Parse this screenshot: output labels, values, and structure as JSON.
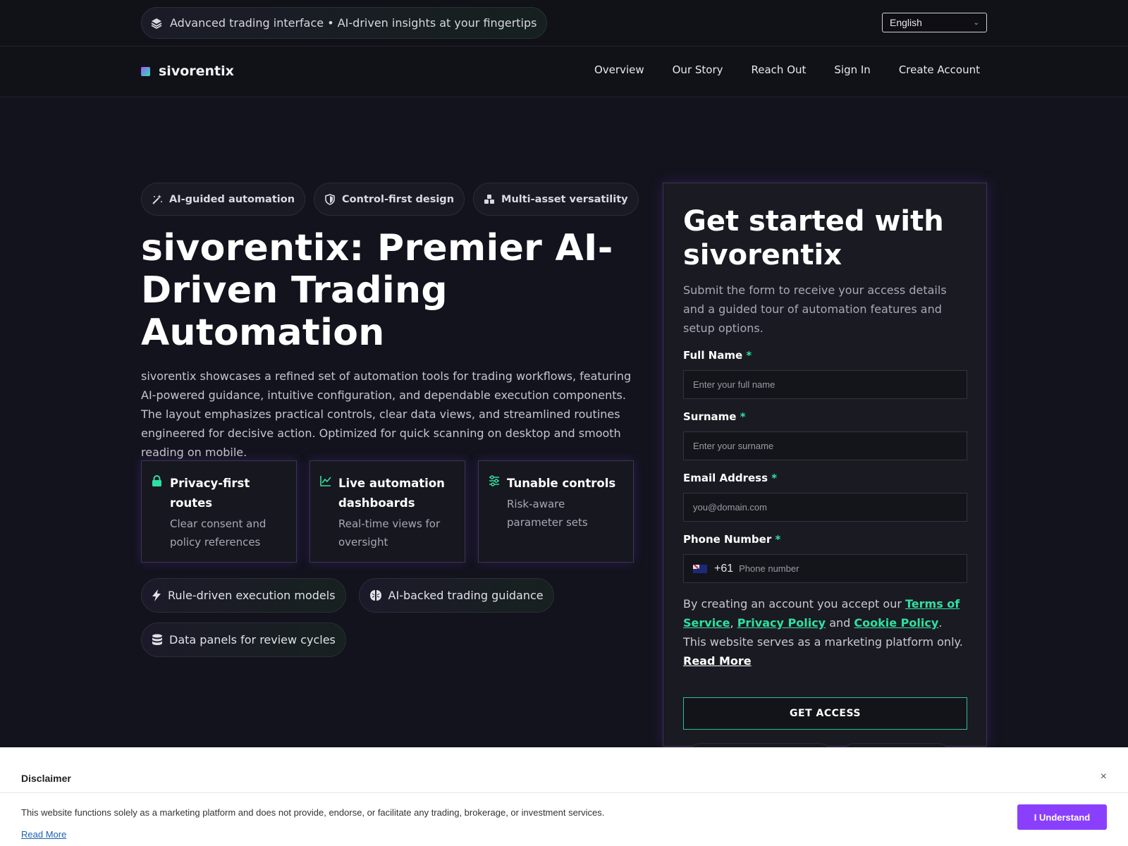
{
  "topbar": {
    "announcement": "Advanced trading interface • AI-driven insights at your fingertips",
    "language": "English"
  },
  "navbar": {
    "brand": "sivorentix",
    "links": [
      "Overview",
      "Our Story",
      "Reach Out",
      "Sign In",
      "Create Account"
    ]
  },
  "hero": {
    "pills": [
      "AI-guided automation",
      "Control-first design",
      "Multi-asset versatility"
    ],
    "headline": "sivorentix: Premier AI-Driven Trading Automation",
    "lede": "sivorentix showcases a refined set of automation tools for trading workflows, featuring AI-powered guidance, intuitive configuration, and dependable execution components. The layout emphasizes practical controls, clear data views, and streamlined routines engineered for decisive action. Optimized for quick scanning on desktop and smooth reading on mobile.",
    "cards": [
      {
        "title": "Privacy-first routes",
        "text": "Clear consent and policy references",
        "icon": "lock-icon"
      },
      {
        "title": "Live automation dashboards",
        "text": "Real-time views for oversight",
        "icon": "chart-line-icon"
      },
      {
        "title": "Tunable controls",
        "text": "Risk-aware parameter sets",
        "icon": "sliders-icon"
      }
    ],
    "tags": [
      "Rule-driven execution models",
      "AI-backed trading guidance",
      "Data panels for review cycles"
    ]
  },
  "form": {
    "title": "Get started with sivorentix",
    "subtitle": "Submit the form to receive your access details and a guided tour of automation features and setup options.",
    "fields": {
      "full_name": {
        "label": "Full Name",
        "placeholder": "Enter your full name"
      },
      "surname": {
        "label": "Surname",
        "placeholder": "Enter your surname"
      },
      "email": {
        "label": "Email Address",
        "placeholder": "you@domain.com"
      },
      "phone": {
        "label": "Phone Number",
        "code": "+61",
        "placeholder": "Phone number"
      }
    },
    "required_mark": "*",
    "terms": {
      "prefix": "By creating an account you accept our ",
      "tos": "Terms of Service",
      "sep1": ", ",
      "privacy": "Privacy Policy",
      "and": " and ",
      "cookie": "Cookie Policy",
      "suffix": ". This website serves as a marketing platform only. ",
      "read_more": "Read More"
    },
    "submit": "GET ACCESS"
  },
  "disclaimer": {
    "title": "Disclaimer",
    "close": "×",
    "text": "This website functions solely as a marketing platform and does not provide, endorse, or facilitate any trading, brokerage, or investment services.",
    "read_more": "Read More",
    "accept": "I Understand"
  },
  "colors": {
    "background": "#13131d",
    "accent_green": "#2fe0a0",
    "accent_purple": "#8a3ffc"
  }
}
